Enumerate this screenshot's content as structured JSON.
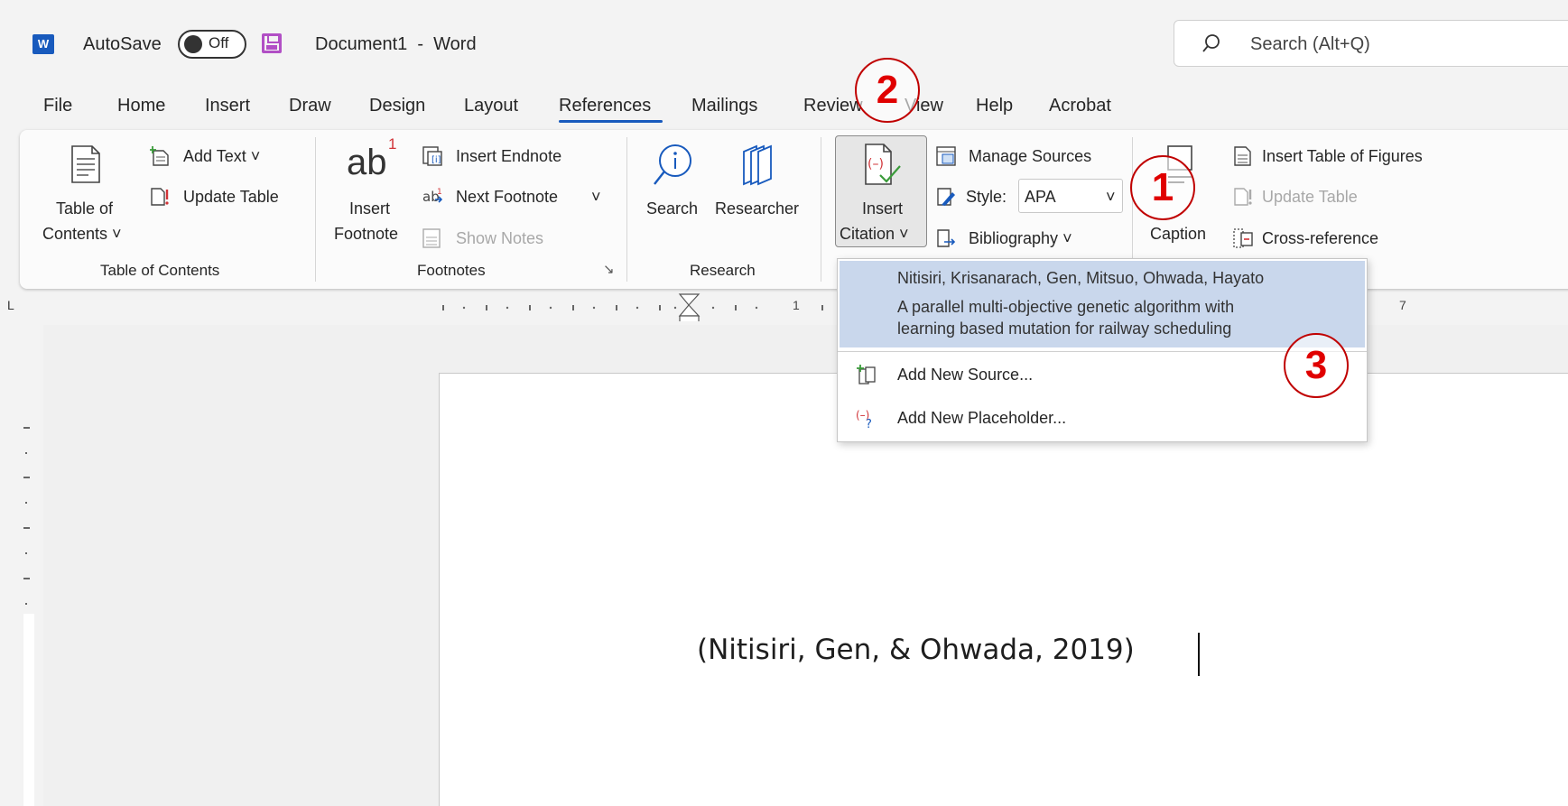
{
  "titlebar": {
    "app_icon": "W",
    "autosave_label": "AutoSave",
    "autosave_state": "Off",
    "document_title": "Document1  -  Word",
    "search_placeholder": "Search (Alt+Q)"
  },
  "menu": {
    "tabs": [
      "File",
      "Home",
      "Insert",
      "Draw",
      "Design",
      "Layout",
      "References",
      "Mailings",
      "Review",
      "View",
      "Help",
      "Acrobat"
    ],
    "active": "References"
  },
  "ribbon": {
    "toc": {
      "table_of_contents_line1": "Table of",
      "table_of_contents_line2": "Contents ˅",
      "add_text": "Add Text ˅",
      "update_table": "Update Table",
      "group_label": "Table of Contents"
    },
    "footnotes": {
      "ab_glyph": "ab",
      "superscript": "1",
      "insert_footnote_line1": "Insert",
      "insert_footnote_line2": "Footnote",
      "insert_endnote": "Insert Endnote",
      "next_footnote": "Next Footnote",
      "next_footnote_chevron": "˅",
      "show_notes": "Show Notes",
      "group_label": "Footnotes",
      "launcher": "↘"
    },
    "research": {
      "search": "Search",
      "researcher": "Researcher",
      "group_label": "Research"
    },
    "citations": {
      "insert_citation_line1": "Insert",
      "insert_citation_line2": "Citation ˅",
      "manage_sources": "Manage Sources",
      "style_label": "Style:",
      "style_value": "APA",
      "style_chevron": "˅",
      "bibliography": "Bibliography ˅"
    },
    "captions": {
      "caption": "Caption",
      "insert_table_of_figures": "Insert Table of Figures",
      "update_table": "Update Table",
      "cross_reference": "Cross-reference"
    }
  },
  "ruler": {
    "corner": "L",
    "tick_one": "1",
    "tick_seven": "7"
  },
  "document": {
    "citation_text": "(Nitisiri, Gen, & Ohwada, 2019)"
  },
  "dropdown": {
    "source_authors": "Nitisiri, Krisanarach, Gen, Mitsuo,  Ohwada, Hayato",
    "source_title_line1": "A parallel multi-objective genetic algorithm with",
    "source_title_line2": "learning based mutation for railway scheduling",
    "add_new_source": "Add New Source...",
    "add_new_placeholder": "Add New Placeholder..."
  },
  "annotations": [
    "1",
    "2",
    "3"
  ],
  "colors": {
    "accent": "#185abd",
    "annotation": "#e00000",
    "selection": "#c9d7ec"
  }
}
